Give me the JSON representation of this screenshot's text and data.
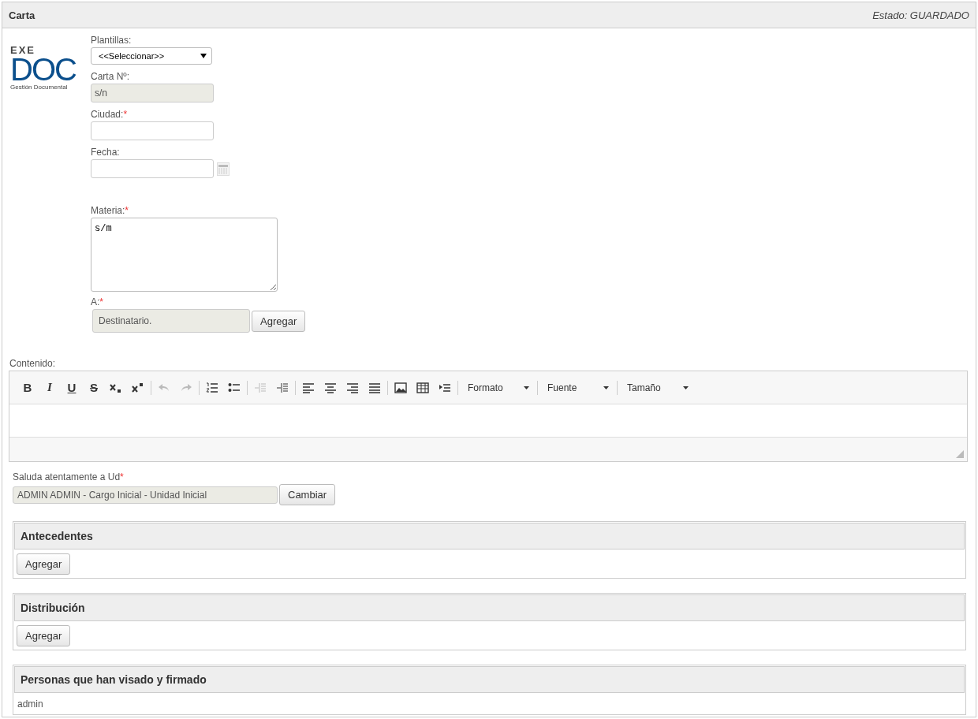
{
  "header": {
    "title": "Carta",
    "status": "Estado: GUARDADO"
  },
  "logo": {
    "top": "EXE",
    "main": "DOC",
    "caption": "Gestión Documental"
  },
  "form": {
    "plantillas": {
      "label": "Plantillas:",
      "value": "<<Seleccionar>>"
    },
    "carta_no": {
      "label": "Carta Nº:",
      "value": "s/n"
    },
    "ciudad": {
      "label": "Ciudad:",
      "required_mark": "*"
    },
    "fecha": {
      "label": "Fecha:"
    },
    "materia": {
      "label": "Materia:",
      "required_mark": "*",
      "value": "s/m"
    },
    "a": {
      "label": "A:",
      "required_mark": "*",
      "value": "Destinatario.",
      "button": "Agregar"
    }
  },
  "editor": {
    "label": "Contenido:",
    "groups": [
      [
        {
          "kind": "bold",
          "label": "B",
          "disabled": false
        },
        {
          "kind": "italic",
          "label": "I",
          "disabled": false
        },
        {
          "kind": "underline",
          "label": "U",
          "disabled": false
        },
        {
          "kind": "strike",
          "label": "S",
          "disabled": false
        },
        {
          "kind": "subscript",
          "disabled": false
        },
        {
          "kind": "superscript",
          "disabled": false
        }
      ],
      [
        {
          "kind": "undo",
          "disabled": true
        },
        {
          "kind": "redo",
          "disabled": true
        }
      ],
      [
        {
          "kind": "numbered-list",
          "disabled": false
        },
        {
          "kind": "bullet-list",
          "disabled": false
        }
      ],
      [
        {
          "kind": "outdent",
          "disabled": true
        },
        {
          "kind": "indent",
          "disabled": false
        }
      ],
      [
        {
          "kind": "align-left",
          "disabled": false
        },
        {
          "kind": "align-center",
          "disabled": false
        },
        {
          "kind": "align-right",
          "disabled": false
        },
        {
          "kind": "justify",
          "disabled": false
        }
      ],
      [
        {
          "kind": "image",
          "disabled": false
        },
        {
          "kind": "table",
          "disabled": false
        },
        {
          "kind": "line",
          "disabled": false
        }
      ]
    ],
    "dropdowns": [
      "Formato",
      "Fuente",
      "Tamaño"
    ]
  },
  "saluda": {
    "label": "Saluda atentamente a Ud",
    "required_mark": "*",
    "value": "ADMIN ADMIN - Cargo Inicial - Unidad Inicial",
    "button": "Cambiar"
  },
  "sections": [
    {
      "title": "Antecedentes",
      "button": "Agregar"
    },
    {
      "title": "Distribución",
      "button": "Agregar"
    },
    {
      "title": "Personas que han visado y firmado",
      "text": "admin"
    }
  ]
}
